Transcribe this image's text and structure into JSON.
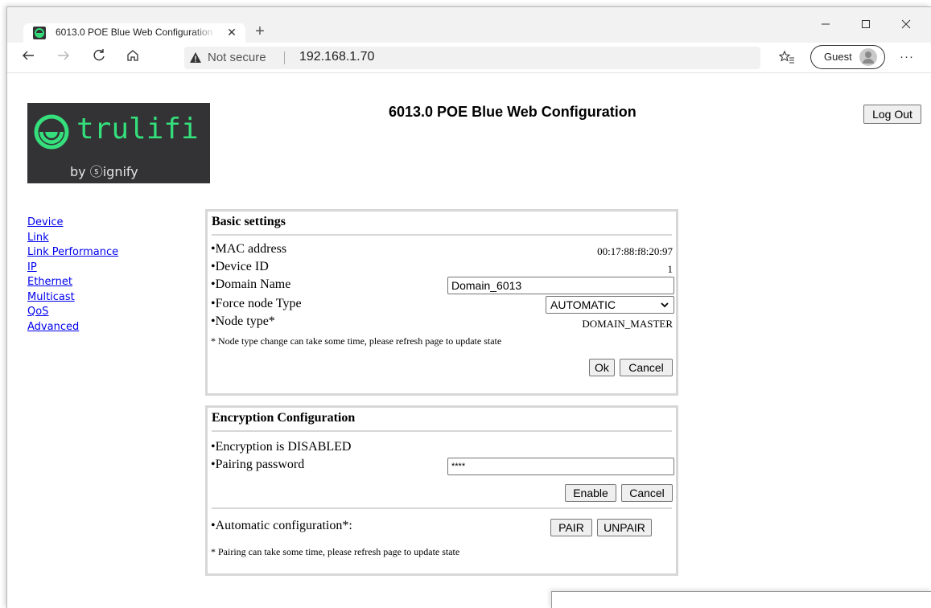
{
  "browser": {
    "tab_title": "6013.0 POE Blue Web Configuration",
    "tab_close": "✕",
    "new_tab": "+",
    "security_label": "Not secure",
    "url": "192.168.1.70",
    "profile_label": "Guest",
    "more_label": "···"
  },
  "header": {
    "logo_text": "trulifi",
    "logo_sub": "by ⓢignify",
    "title": "6013.0 POE Blue Web Configuration",
    "logout_label": "Log Out"
  },
  "sidebar": {
    "items": [
      {
        "label": "Device"
      },
      {
        "label": "Link"
      },
      {
        "label": "Link Performance"
      },
      {
        "label": "IP"
      },
      {
        "label": "Ethernet"
      },
      {
        "label": "Multicast"
      },
      {
        "label": "QoS"
      },
      {
        "label": "Advanced"
      }
    ]
  },
  "basic": {
    "heading": "Basic settings",
    "mac_label": "•MAC address",
    "mac_value": "00:17:88:f8:20:97",
    "device_id_label": "•Device ID",
    "device_id_value": "1",
    "domain_label": "•Domain Name",
    "domain_value": "Domain_6013",
    "force_label": "•Force node Type",
    "force_value": "AUTOMATIC",
    "node_type_label": "•Node type*",
    "node_type_value": "DOMAIN_MASTER",
    "note": "* Node type change can take some time, please refresh page to update state",
    "ok_label": "Ok",
    "cancel_label": "Cancel"
  },
  "encryption": {
    "heading": "Encryption Configuration",
    "status": "•Encryption is DISABLED",
    "password_label": "•Pairing password",
    "password_value": "****",
    "enable_label": "Enable",
    "cancel_label": "Cancel",
    "auto_label": "•Automatic configuration*:",
    "pair_label": "PAIR",
    "unpair_label": "UNPAIR",
    "note": "* Pairing can take some time, please refresh page to update state"
  },
  "colors": {
    "brand_green": "#34df7c",
    "logo_bg": "#333335",
    "link": "#0000ee"
  }
}
